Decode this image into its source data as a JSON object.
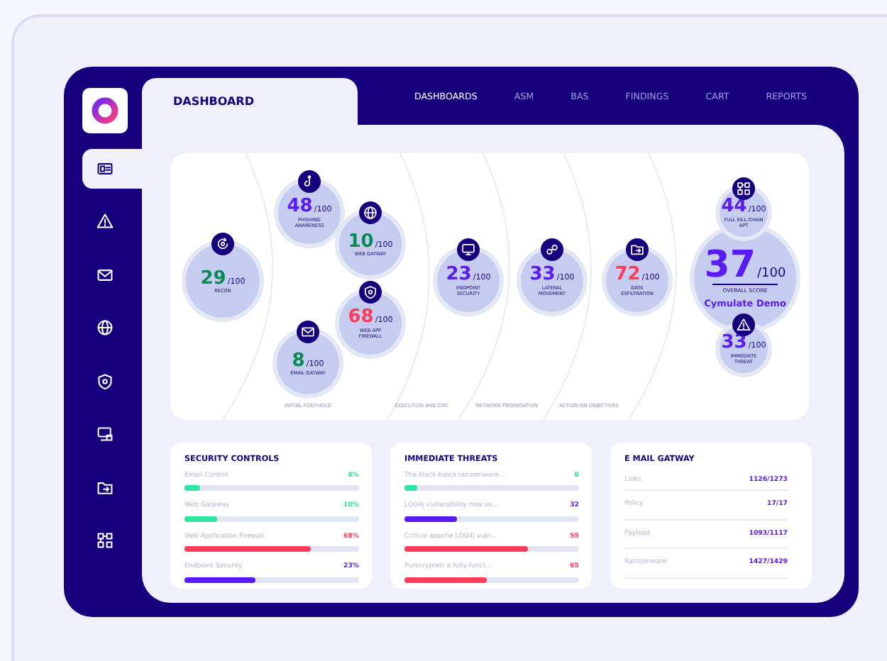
{
  "sidebar": {
    "items": [
      {
        "selected": true
      },
      {
        "selected": false
      },
      {
        "selected": false
      },
      {
        "selected": false
      },
      {
        "selected": false
      },
      {
        "selected": false
      },
      {
        "selected": false
      },
      {
        "selected": false
      }
    ]
  },
  "header": {
    "title": "DASHBOARD"
  },
  "nav": [
    {
      "label": "DASHBOARDS",
      "selected": true
    },
    {
      "label": "ASM",
      "selected": false
    },
    {
      "label": "BAS",
      "selected": false
    },
    {
      "label": "FINDINGS",
      "selected": false
    },
    {
      "label": "CART",
      "selected": false
    },
    {
      "label": "REPORTS",
      "selected": false
    }
  ],
  "kill_chain": {
    "nodes": [
      {
        "kind": "small",
        "value": "29",
        "max": "/100",
        "label": "RECON",
        "color": "#0a8a55"
      },
      {
        "kind": "small",
        "value": "48",
        "max": "/100",
        "label": "PHISHING AWARENESS",
        "color": "#5a1cf5"
      },
      {
        "kind": "small",
        "value": "10",
        "max": "/100",
        "label": "WEB GATWAY",
        "color": "#0a8a55"
      },
      {
        "kind": "small",
        "value": "68",
        "max": "/100",
        "label": "WEB APP FIREWALL",
        "color": "#ff3b5c"
      },
      {
        "kind": "small",
        "value": "8",
        "max": "/100",
        "label": "EMAIL GATWAY",
        "color": "#0a8a55"
      },
      {
        "kind": "small",
        "value": "23",
        "max": "/100",
        "label": "ENDPOINT SECURITY",
        "color": "#5a1cf5"
      },
      {
        "kind": "small",
        "value": "33",
        "max": "/100",
        "label": "LATERAL MOVEMENT",
        "color": "#5a1cf5"
      },
      {
        "kind": "small",
        "value": "72",
        "max": "/100",
        "label": "DATA EXFILTRATION",
        "color": "#ff3b5c"
      },
      {
        "kind": "small",
        "value": "44",
        "max": "/100",
        "label": "FULL KILL-CHAIN APT",
        "color": "#5a1cf5"
      },
      {
        "kind": "overall",
        "value": "37",
        "max": "/100",
        "label": "OVERALL SCORE",
        "subtitle": "Cymulate Demo",
        "color": "#5a1cf5"
      },
      {
        "kind": "small",
        "value": "33",
        "max": "/100",
        "label": "IMMEDIATE THREAT",
        "color": "#5a1cf5"
      }
    ],
    "stages": [
      "INITIAL FOOTHOLD",
      "EXECUTION AND CNC",
      "NETWORK PROPAGATION",
      "ACTION ON OBJECTIVES"
    ]
  },
  "cards": [
    {
      "kind": "bars",
      "title": "SECURITY CONTROLS",
      "rows": [
        {
          "label": "Email Control",
          "value": "8%",
          "level": 0.09,
          "color": "#2ee59d"
        },
        {
          "label": "Web Gateway",
          "value": "10%",
          "level": 0.19,
          "color": "#2ee59d"
        },
        {
          "label": "Web Application Firewall",
          "value": "68%",
          "level": 0.72,
          "color": "#ff3b5c"
        },
        {
          "label": "Endpoint Security",
          "value": "23%",
          "level": 0.41,
          "color": "#5a1cf5"
        }
      ]
    },
    {
      "kind": "bars",
      "title": "IMMEDIATE THREATS",
      "rows": [
        {
          "label": "The black basta ransomware...",
          "value": "8",
          "level": 0.07,
          "color": "#2ee59d"
        },
        {
          "label": "LOG4j vulnerability now us...",
          "value": "32",
          "level": 0.3,
          "color": "#5a1cf5"
        },
        {
          "label": "Critical apache LOG4j vuln...",
          "value": "55",
          "level": 0.71,
          "color": "#ff3b5c"
        },
        {
          "label": "Purecrypter: a fully-funct...",
          "value": "65",
          "level": 0.47,
          "color": "#ff3b5c"
        }
      ]
    },
    {
      "kind": "ratios",
      "title": "E MAIL GATWAY",
      "rows": [
        {
          "label": "Links",
          "value": "1126/1273"
        },
        {
          "label": "Policy",
          "value": "17/17"
        },
        {
          "label": "Payload",
          "value": "1093/1117"
        },
        {
          "label": "Ransomware",
          "value": "1427/1429"
        }
      ]
    }
  ]
}
